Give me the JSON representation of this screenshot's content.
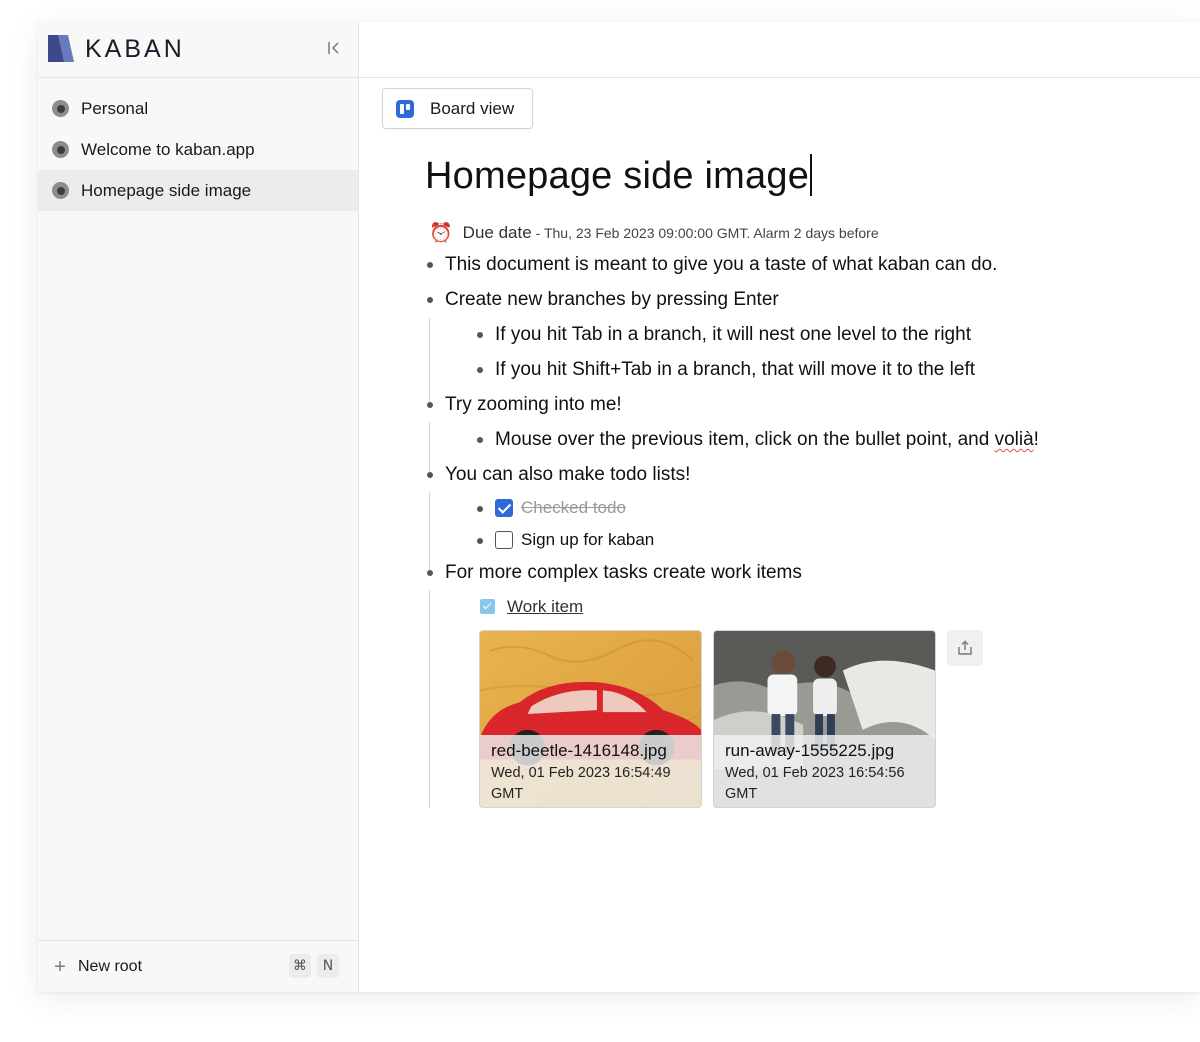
{
  "app": {
    "brand": "KABAN"
  },
  "sidebar": {
    "items": [
      {
        "label": "Personal"
      },
      {
        "label": "Welcome to kaban.app"
      },
      {
        "label": "Homepage side image"
      }
    ],
    "footer": {
      "new_root_label": "New root",
      "shortcut_mod": "⌘",
      "shortcut_key": "N"
    }
  },
  "toolbar": {
    "board_view_label": "Board view"
  },
  "document": {
    "title": "Homepage side image",
    "due": {
      "label": "Due date",
      "text": "- Thu, 23 Feb 2023 09:00:00 GMT. Alarm 2 days before"
    },
    "items": {
      "i1": "This document is meant to give you a taste of what kaban can do.",
      "i2": "Create new branches by pressing Enter",
      "i2a": "If you hit Tab in a branch, it will nest one level to the right",
      "i2b": "If you hit Shift+Tab in a branch, that will move it to the left",
      "i3": "Try zooming into me!",
      "i3a_pre": "Mouse over the previous item, click on the bullet point, and ",
      "i3a_word": "volià",
      "i3a_post": "!",
      "i4": "You can also make todo lists!",
      "todo1": "Checked todo",
      "todo2": "Sign up for kaban",
      "i5": "For more complex tasks create work items",
      "work_item": "Work item"
    },
    "attachments": [
      {
        "name": "red-beetle-1416148.jpg",
        "date_line1": "Wed, 01 Feb 2023 16:54:49",
        "date_line2": "GMT"
      },
      {
        "name": "run-away-1555225.jpg",
        "date_line1": "Wed, 01 Feb 2023 16:54:56",
        "date_line2": "GMT"
      }
    ]
  },
  "icons": {
    "logo": "kaban-logo-icon",
    "collapse": "collapse-sidebar-icon",
    "board": "board-view-icon",
    "alarm": "alarm-clock-icon",
    "share": "share-icon",
    "plus": "plus-icon"
  },
  "colors": {
    "accent": "#2f6bd8",
    "work_item": "#8cc6ea",
    "logo_dark": "#3c4a8c",
    "logo_light": "#7d8cc8"
  }
}
